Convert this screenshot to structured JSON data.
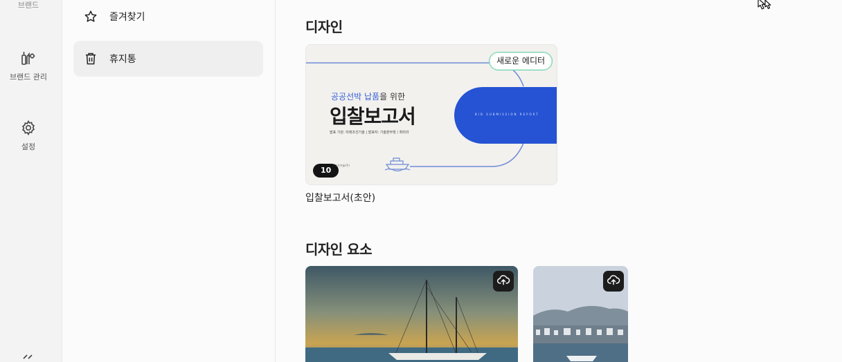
{
  "rail": {
    "items": [
      {
        "label": "브랜드",
        "icon": "brand-icon"
      },
      {
        "label": "브랜드 관리",
        "icon": "brand-manage-icon"
      },
      {
        "label": "설정",
        "icon": "gear-icon"
      }
    ],
    "collapse_icon": "double-chevron-left-icon"
  },
  "panel": {
    "items": [
      {
        "label": "즐겨찾기",
        "icon": "star-icon",
        "active": false
      },
      {
        "label": "휴지통",
        "icon": "trash-icon",
        "active": true
      }
    ]
  },
  "main": {
    "design_section": {
      "title": "디자인",
      "cards": [
        {
          "name": "입찰보고서(초안)",
          "page_count": "10",
          "badge": "새로운 에디터",
          "thumbnail": {
            "subtitle_highlight": "공공선박 납품",
            "subtitle_rest": "을 위한",
            "title": "입찰보고서",
            "meta": "발표 기관: 미래조선기술 | 발표자: 기술본부장 / 최미라",
            "pill_text": "BID SUBMISSION REPORT",
            "small_text": "미래조선기술(주)"
          }
        }
      ]
    },
    "elements_section": {
      "title": "디자인 요소",
      "items": [
        {
          "kind": "photo",
          "subject": "sailboat-at-sunset",
          "upload_icon": "cloud-upload-icon"
        },
        {
          "kind": "photo",
          "subject": "harbor-city",
          "upload_icon": "cloud-upload-icon"
        }
      ]
    }
  },
  "colors": {
    "accent_blue": "#2553d3",
    "rail_bg": "#f3f3f3",
    "active_bg": "#efefef",
    "badge_border": "#6fd0c0"
  }
}
